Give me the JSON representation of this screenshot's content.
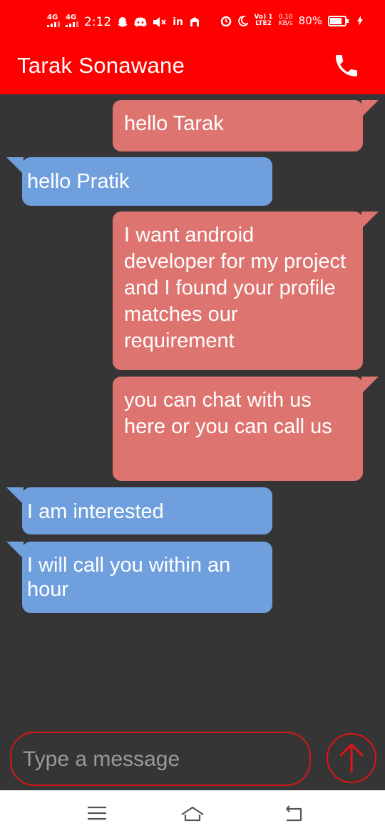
{
  "status_bar": {
    "time": "2:12",
    "sim1": "4G",
    "sim2": "4G",
    "linkedin_label": "in",
    "network_volte": "Vo) 1",
    "network_lte": "LTE2",
    "speed_value": "0.10",
    "speed_unit": "KB/s",
    "battery_percent": "80%",
    "battery_level": 0.8,
    "icons": [
      "signal-icon",
      "snapchat-icon",
      "discord-icon",
      "mute-icon",
      "linkedin-icon",
      "notification-icon",
      "alarm-icon",
      "moon-icon",
      "charging-icon"
    ]
  },
  "header": {
    "title": "Tarak Sonawane",
    "call_icon": "phone-icon"
  },
  "colors": {
    "header_bg": "#ff0000",
    "chat_bg": "#353535",
    "sent_bubble": "#de7470",
    "received_bubble": "#6f9fdc",
    "accent_border": "#d41818"
  },
  "messages": [
    {
      "direction": "sent",
      "text": "hello Tarak"
    },
    {
      "direction": "received",
      "text": "hello Pratik"
    },
    {
      "direction": "sent",
      "text": "I want android developer for my project and I found your profile matches our requirement"
    },
    {
      "direction": "sent",
      "text": "you can chat with us here or you can call us"
    },
    {
      "direction": "received",
      "text": "I am interested"
    },
    {
      "direction": "received",
      "text": "I will call you within an hour"
    }
  ],
  "composer": {
    "placeholder": "Type a message",
    "value": "",
    "send_icon": "arrow-up-icon"
  },
  "nav_bar": {
    "icons": [
      "menu-icon",
      "home-icon",
      "back-icon"
    ]
  }
}
